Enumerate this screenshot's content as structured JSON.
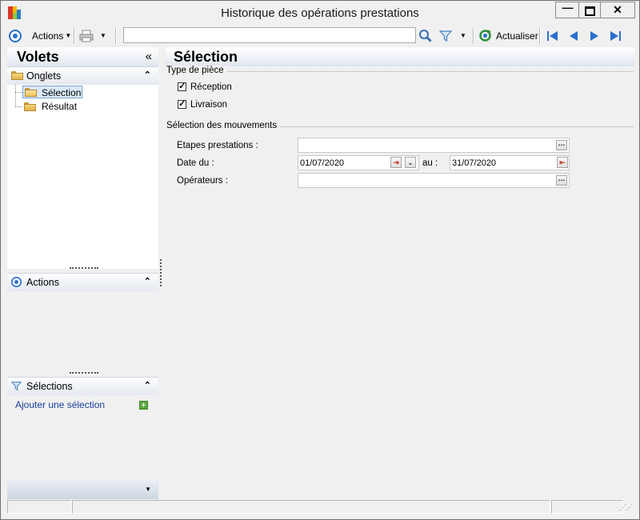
{
  "window": {
    "title": "Historique des opérations prestations"
  },
  "toolbar": {
    "actions_label": "Actions",
    "search_value": "",
    "refresh_label": "Actualiser"
  },
  "left": {
    "title": "Volets",
    "collapse_glyph": "«",
    "onglets": {
      "title": "Onglets",
      "items": [
        {
          "label": "Sélection",
          "selected": true,
          "icon": "open-folder-icon"
        },
        {
          "label": "Résultat",
          "selected": false,
          "icon": "folder-icon"
        }
      ]
    },
    "actions": {
      "title": "Actions"
    },
    "selections": {
      "title": "Sélections",
      "add_label": "Ajouter une sélection"
    }
  },
  "main": {
    "title": "Sélection",
    "type_piece": {
      "legend": "Type de pièce",
      "options": [
        {
          "label": "Réception",
          "checked": true
        },
        {
          "label": "Livraison",
          "checked": true
        }
      ]
    },
    "mouvements": {
      "legend": "Sélection des mouvements",
      "etapes_label": "Etapes prestations :",
      "etapes_value": "",
      "date_label": "Date du :",
      "date_from": "01/07/2020",
      "au_label": "au :",
      "date_to": "31/07/2020",
      "operateurs_label": "Opérateurs :",
      "operateurs_value": ""
    }
  },
  "icons": {
    "app": "app-logo-icon",
    "actions": "circle-target-icon",
    "print": "printer-icon",
    "search": "magnifier-icon",
    "filter": "funnel-icon",
    "refresh": "refresh-icon",
    "nav": [
      "first-icon",
      "previous-icon",
      "next-icon",
      "last-icon"
    ]
  },
  "colors": {
    "link": "#1a3e9b",
    "accent": "#2a6fcf"
  }
}
